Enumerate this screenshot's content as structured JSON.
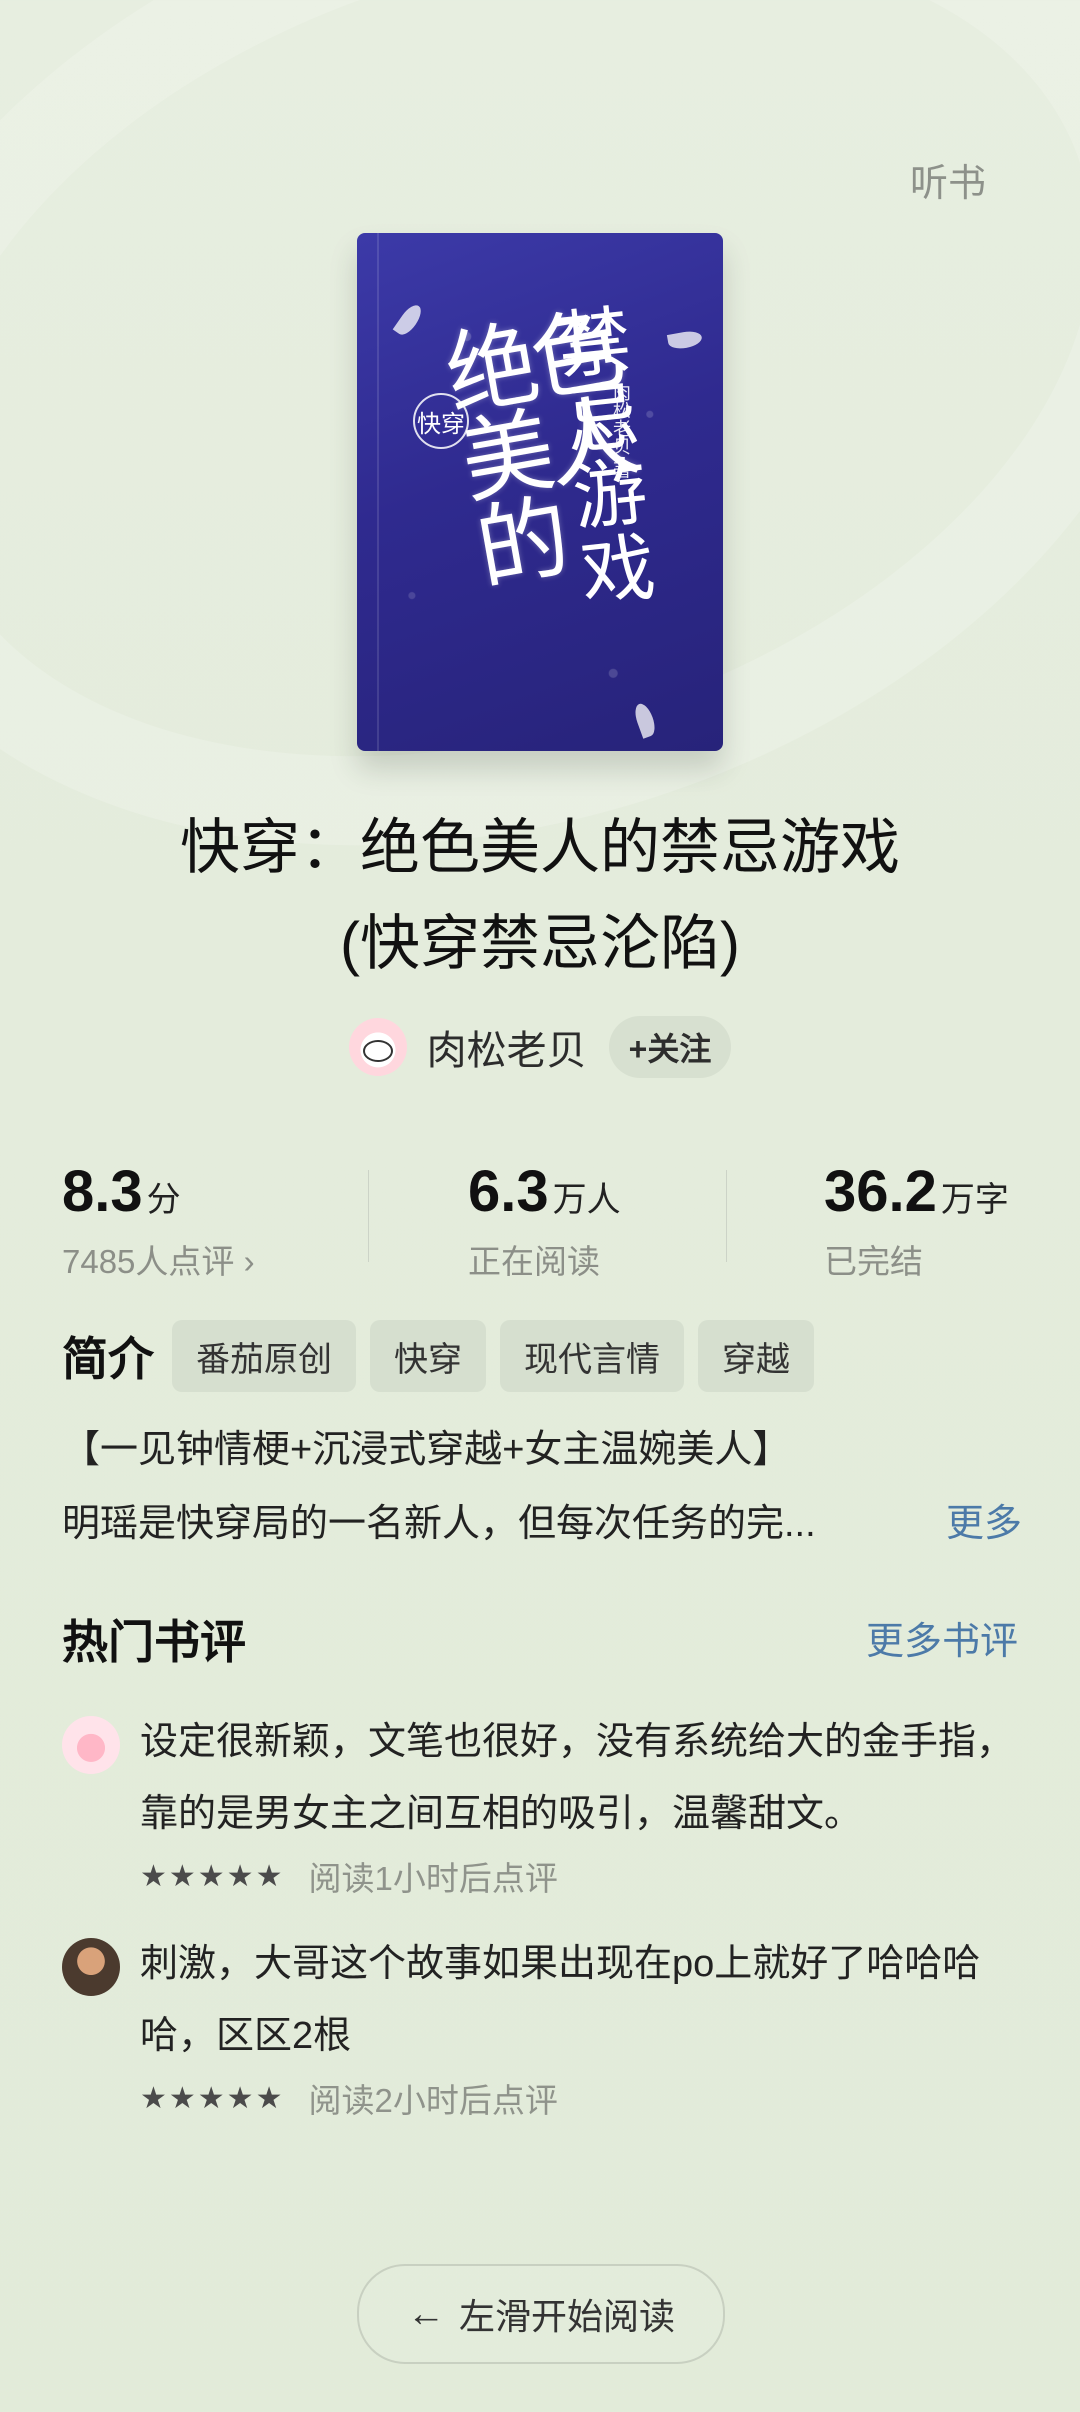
{
  "header": {
    "listen_label": "听书"
  },
  "book": {
    "title_line1": "快穿：绝色美人的禁忌游戏",
    "title_line2": "(快穿禁忌沦陷)",
    "cover": {
      "tag": "快穿",
      "main_text": "绝色美人的",
      "side_text": "禁忌游戏",
      "author_text": "肉松老贝 著",
      "colors": {
        "primary": "#3c3aa8",
        "dark": "#27237a"
      }
    },
    "author": {
      "name": "肉松老贝",
      "follow_label": "+关注"
    }
  },
  "stats": {
    "score": {
      "value": "8.3",
      "unit": "分",
      "label": "7485人点评 ›"
    },
    "reading": {
      "value": "6.3",
      "unit": "万人",
      "label": "正在阅读"
    },
    "words": {
      "value": "36.2",
      "unit": "万字",
      "label": "已完结"
    }
  },
  "intro": {
    "label": "简介",
    "tags": [
      "番茄原创",
      "快穿",
      "现代言情",
      "穿越"
    ],
    "line1": "【一见钟情梗+沉浸式穿越+女主温婉美人】",
    "line2": "明瑶是快穿局的一名新人，但每次任务的完...",
    "more_label": "更多"
  },
  "reviews": {
    "section_title": "热门书评",
    "more_label": "更多书评",
    "items": [
      {
        "text": "设定很新颖，文笔也很好，没有系统给大的金手指，靠的是男女主之间互相的吸引，温馨甜文。",
        "stars": "★★★★★",
        "meta": "阅读1小时后点评",
        "avatar": "avatar-pink"
      },
      {
        "text": "刺激，大哥这个故事如果出现在po上就好了哈哈哈哈，区区2根",
        "stars": "★★★★★",
        "meta": "阅读2小时后点评",
        "avatar": "avatar-photo"
      }
    ]
  },
  "bottom": {
    "read_label": "左滑开始阅读",
    "arrow_icon": "arrow-left-icon"
  },
  "colors": {
    "background": "#e4ecdc",
    "link": "#4c7aa8",
    "tag_bg": "#d6dfcf"
  }
}
